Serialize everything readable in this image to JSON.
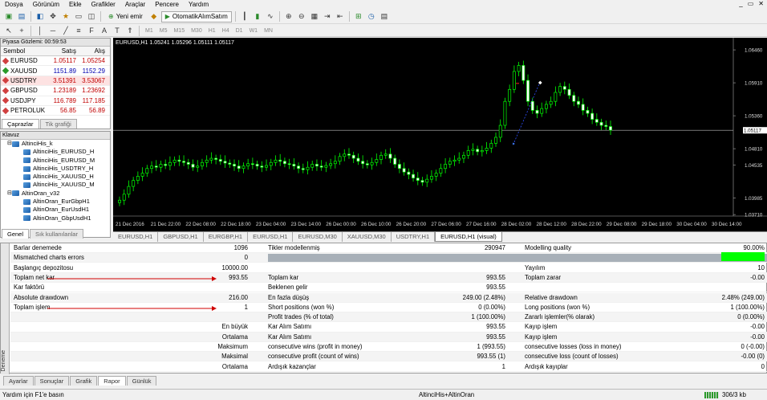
{
  "menu": [
    "Dosya",
    "Görünüm",
    "Ekle",
    "Grafikler",
    "Araçlar",
    "Pencere",
    "Yardım"
  ],
  "toolbar": {
    "new_order": "Yeni emir",
    "autotrade": "OtomatikAlımSatım",
    "timeframes": [
      "M1",
      "M5",
      "M15",
      "M30",
      "H1",
      "H4",
      "D1",
      "W1",
      "MN"
    ]
  },
  "market": {
    "title": "Piyasa Gözlemi: 00:59:53",
    "headers": [
      "Sembol",
      "Satış",
      "Alış"
    ],
    "rows": [
      {
        "symbol": "EURUSD",
        "bid": "1.05117",
        "ask": "1.05254",
        "color": "#d04040",
        "style": "red"
      },
      {
        "symbol": "XAUUSD",
        "bid": "1151.89",
        "ask": "1152.29",
        "color": "#2a9a2a",
        "style": "blue"
      },
      {
        "symbol": "USDTRY",
        "bid": "3.51391",
        "ask": "3.53067",
        "color": "#d04040",
        "style": "pink"
      },
      {
        "symbol": "GBPUSD",
        "bid": "1.23189",
        "ask": "1.23692",
        "color": "#d04040",
        "style": "red"
      },
      {
        "symbol": "USDJPY",
        "bid": "116.789",
        "ask": "117.185",
        "color": "#d04040",
        "style": "red"
      },
      {
        "symbol": "PETROLUK",
        "bid": "56.85",
        "ask": "56.89",
        "color": "#d04040",
        "style": "red"
      }
    ],
    "tabs": [
      "Çaprazlar",
      "Tik grafiği"
    ]
  },
  "navigator": {
    "title": "Klavuz",
    "items": [
      {
        "label": "AltinciHis_k",
        "indent": 1,
        "folder": true
      },
      {
        "label": "AltinciHis_EURUSD_H",
        "indent": 2
      },
      {
        "label": "AltinciHis_EURUSD_M",
        "indent": 2
      },
      {
        "label": "AltinciHis_USDTRY_H",
        "indent": 2
      },
      {
        "label": "AltinciHis_XAUUSD_H",
        "indent": 2
      },
      {
        "label": "AltinciHis_XAUUSD_M",
        "indent": 2
      },
      {
        "label": "AltinOran_v32",
        "indent": 1,
        "folder": true
      },
      {
        "label": "AltinOran_EurGbpH1",
        "indent": 2
      },
      {
        "label": "AltinOran_EurUsdH1",
        "indent": 2
      },
      {
        "label": "AltinOran_GbpUsdH1",
        "indent": 2
      }
    ],
    "tabs": [
      "Genel",
      "Sık kullanılanlar"
    ]
  },
  "chart": {
    "header": "EURUSD,H1  1.05241 1.05296 1.05111 1.05117",
    "current_price": "1.05117",
    "price_labels": [
      "1.06460",
      "1.05910",
      "1.05360",
      "1.04810",
      "1.04535",
      "1.03985",
      "1.03710"
    ],
    "date_labels": [
      "21 Dec 2016",
      "21 Dec 22:00",
      "22 Dec 08:00",
      "22 Dec 18:00",
      "23 Dec 04:00",
      "23 Dec 14:00",
      "26 Dec 00:00",
      "26 Dec 10:00",
      "26 Dec 20:00",
      "27 Dec 06:00",
      "27 Dec 16:00",
      "28 Dec 02:00",
      "28 Dec 12:00",
      "28 Dec 22:00",
      "29 Dec 08:00",
      "29 Dec 18:00",
      "30 Dec 04:00",
      "30 Dec 14:00"
    ],
    "close_series": [
      1.0395,
      1.0405,
      1.0418,
      1.0428,
      1.0435,
      1.044,
      1.0448,
      1.0452,
      1.045,
      1.0455,
      1.0453,
      1.0458,
      1.0462,
      1.046,
      1.0458,
      1.0455,
      1.045,
      1.0452,
      1.0458,
      1.0462,
      1.0465,
      1.0463,
      1.046,
      1.0457,
      1.0455,
      1.0452,
      1.0448,
      1.0452,
      1.0456,
      1.0455,
      1.0452,
      1.045,
      1.0453,
      1.0458,
      1.0462,
      1.046,
      1.0456,
      1.0455,
      1.0452,
      1.0448,
      1.0446,
      1.045,
      1.0455,
      1.0452,
      1.045,
      1.0453,
      1.0456,
      1.046,
      1.0468,
      1.0472,
      1.047,
      1.0465,
      1.046,
      1.0456,
      1.0454,
      1.0458,
      1.0463,
      1.047,
      1.0472,
      1.0465,
      1.0455,
      1.0448,
      1.0442,
      1.0438,
      1.0432,
      1.0428,
      1.0425,
      1.043,
      1.0435,
      1.044,
      1.0448,
      1.0455,
      1.046,
      1.0462,
      1.0465,
      1.047,
      1.0478,
      1.048,
      1.0476,
      1.0478,
      1.0482,
      1.049,
      1.05,
      1.052,
      1.056,
      1.058,
      1.061,
      1.062,
      1.0595,
      1.056,
      1.0545,
      1.054,
      1.0548,
      1.0555,
      1.056,
      1.0575,
      1.0585,
      1.058,
      1.057,
      1.056,
      1.0555,
      1.0545,
      1.054,
      1.053,
      1.0525,
      1.052,
      1.0518,
      1.0512
    ]
  },
  "chart_tabs": [
    "EURUSD,H1",
    "GBPUSD,H1",
    "EURGBP,H1",
    "EURUSD,H1",
    "EURUSD,M30",
    "XAUUSD,M30",
    "USDTRY,H1",
    "EURUSD,H1 (visual)"
  ],
  "report": {
    "rows": [
      {
        "c1": "Barlar denemede",
        "v1": "1096",
        "c2": "Tikler modellenmiş",
        "v2": "290947",
        "c3": "Modelling quality",
        "v3": "90.00%"
      },
      {
        "c1": "Mismatched charts errors",
        "v1": "0",
        "bar": true
      },
      {
        "c1": "Başlangıç depozitosu",
        "v1": "10000.00",
        "c3": "Yayılım",
        "v3": "10"
      },
      {
        "c1": "Toplam net kar",
        "v1": "993.55",
        "c2": "Toplam kar",
        "v2": "993.55",
        "c3": "Toplam zarar",
        "v3": "-0.00",
        "arrow": true
      },
      {
        "c1": "Kar faktörü",
        "v1": "",
        "c2": "Beklenen gelir",
        "v2": "993.55"
      },
      {
        "c1": "Absolute drawdown",
        "v1": "216.00",
        "c2": "En fazla düşüş",
        "v2": "249.00 (2.48%)",
        "c3": "Relative drawdown",
        "v3": "2.48% (249.00)"
      },
      {
        "c1": "Toplam işlem",
        "v1": "1",
        "c2": "Short positions (won %)",
        "v2": "0 (0.00%)",
        "c3": "Long positions (won %)",
        "v3": "1 (100.00%)",
        "arrow": true
      },
      {
        "c2": "Profit trades (% of total)",
        "v2": "1 (100.00%)",
        "c3": "Zararlı işlemler(% olarak)",
        "v3": "0 (0.00%)"
      },
      {
        "c1r": "En büyük",
        "c2": "Kar Alım Satımı",
        "v2": "993.55",
        "c3": "Kayıp işlem",
        "v3": "-0.00"
      },
      {
        "c1r": "Ortalama",
        "c2": "Kar Alım Satımı",
        "v2": "993.55",
        "c3": "Kayıp işlem",
        "v3": "-0.00"
      },
      {
        "c1r": "Maksimum",
        "c2": "consecutive wins (profit in money)",
        "v2": "1 (993.55)",
        "c3": "consecutive losses (loss in money)",
        "v3": "0 (-0.00)"
      },
      {
        "c1r": "Maksimal",
        "c2": "consecutive profit (count of wins)",
        "v2": "993.55 (1)",
        "c3": "consecutive loss (count of losses)",
        "v3": "-0.00 (0)"
      },
      {
        "c1r": "Ortalama",
        "c2": "Ardışık kazançlar",
        "v2": "1",
        "c3": "Ardışık kayıplar",
        "v3": "0"
      }
    ],
    "side_label": "Deneme"
  },
  "bottom_tabs": [
    "Ayarlar",
    "Sonuçlar",
    "Grafik",
    "Rapor",
    "Günlük"
  ],
  "status": {
    "help": "Yardım için F1'e basın",
    "profile": "AltinciHis+AltinOran",
    "traffic": "306/3 kb"
  }
}
